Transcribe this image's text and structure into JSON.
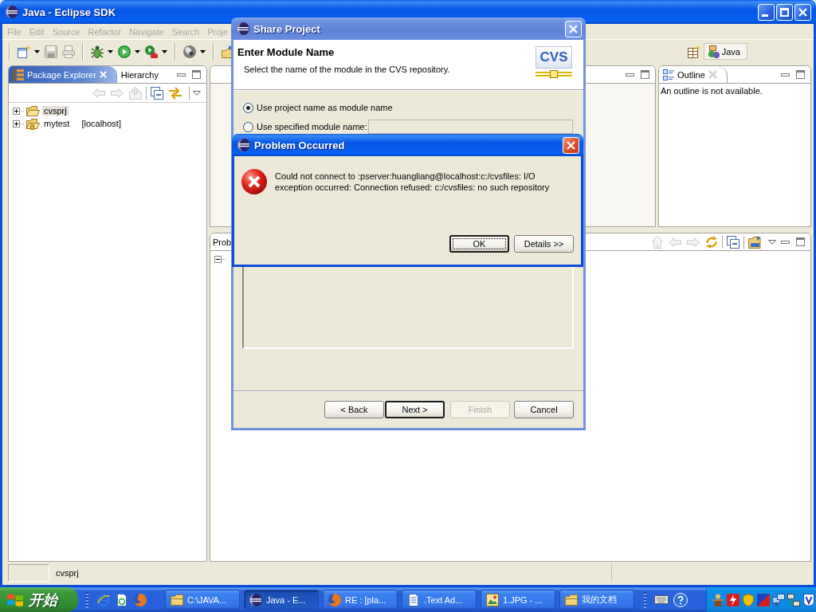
{
  "window": {
    "title": "Java - Eclipse SDK"
  },
  "menu": [
    {
      "label": "File",
      "disabled": true
    },
    {
      "label": "Edit",
      "disabled": true
    },
    {
      "label": "Source",
      "disabled": true
    },
    {
      "label": "Refactor",
      "disabled": true
    },
    {
      "label": "Navigate",
      "disabled": true
    },
    {
      "label": "Search",
      "disabled": true
    },
    {
      "label": "Proje",
      "disabled": true
    }
  ],
  "toolbar": {
    "groups": [
      [
        {
          "kind": "new",
          "dropdown": true,
          "disabled": false
        },
        {
          "kind": "save",
          "dropdown": false,
          "disabled": true
        },
        {
          "kind": "print",
          "dropdown": false,
          "disabled": true
        }
      ],
      [
        {
          "kind": "bug",
          "dropdown": true,
          "disabled": false
        },
        {
          "kind": "run",
          "dropdown": true,
          "disabled": false
        },
        {
          "kind": "run-tools",
          "dropdown": true,
          "disabled": false
        }
      ],
      [
        {
          "kind": "disc",
          "dropdown": true,
          "disabled": false
        }
      ],
      [
        {
          "kind": "folder-arrow",
          "dropdown": false,
          "disabled": false
        }
      ]
    ]
  },
  "perspectives": [
    {
      "label": "Java",
      "selected": true
    }
  ],
  "package_explorer": {
    "active": true,
    "tabs": [
      {
        "label": "Package Explorer",
        "selected": true,
        "closable": true
      },
      {
        "label": "Hierarchy",
        "selected": false,
        "closable": false
      }
    ],
    "toolbar": [
      [
        {
          "kind": "back",
          "disabled": true
        },
        {
          "kind": "forward",
          "disabled": true
        },
        {
          "kind": "up",
          "disabled": true
        }
      ],
      [
        {
          "kind": "collapse-all",
          "disabled": false
        },
        {
          "kind": "link",
          "disabled": false
        }
      ]
    ],
    "tree": [
      {
        "label": "cvsprj",
        "expanded": false,
        "selected": true,
        "shared": false
      },
      {
        "label": "mytest",
        "decoration": "[localhost]",
        "expanded": false,
        "selected": false,
        "shared": true
      }
    ]
  },
  "outline": {
    "active": false,
    "tabs": [
      {
        "label": "Outline",
        "selected": true,
        "closable": true
      }
    ],
    "message": "An outline is not available."
  },
  "problems": {
    "active": false,
    "tabs": [
      {
        "label": "Prob",
        "selected": true
      }
    ],
    "toolbar": [
      [
        {
          "kind": "home",
          "disabled": true
        },
        {
          "kind": "back",
          "disabled": true
        },
        {
          "kind": "forward",
          "disabled": true
        },
        {
          "kind": "sync",
          "disabled": false
        }
      ],
      [
        {
          "kind": "collapse-all",
          "disabled": false
        }
      ],
      [
        {
          "kind": "cvs-folder",
          "disabled": false
        }
      ]
    ],
    "tree": [
      {
        "expanded": true
      }
    ]
  },
  "status_bar": {
    "message": "cvsprj"
  },
  "share_dialog": {
    "title": "Share Project",
    "active": false,
    "heading": "Enter Module Name",
    "description": "Select the name of the module in the CVS repository.",
    "banner_logo": "CVS",
    "options": [
      {
        "label": "Use project name as module name",
        "selected": true
      },
      {
        "label": "Use specified module name:",
        "selected": false
      }
    ],
    "module_field": {
      "disabled": true
    },
    "buttons": [
      {
        "label": "< Back",
        "default": false,
        "disabled": false
      },
      {
        "label": "Next >",
        "default": true,
        "disabled": false
      },
      {
        "label": "Finish",
        "default": false,
        "disabled": true
      },
      {
        "label": "Cancel",
        "default": false,
        "disabled": false
      }
    ]
  },
  "problem_dialog": {
    "title": "Problem Occurred",
    "active": true,
    "message": "Could not connect to :pserver:huangliang@localhost:c:/cvsfiles: I/O exception occurred: Connection refused: c:/cvsfiles: no such repository",
    "buttons": [
      {
        "label": "OK",
        "focused": true
      },
      {
        "label": "Details >>",
        "focused": false
      }
    ]
  },
  "taskbar": {
    "start_label": "开始",
    "tasks": [
      {
        "label": "C:\\JAVA...",
        "kind": "folder",
        "selected": false
      },
      {
        "label": "Java - E...",
        "kind": "eclipse",
        "selected": true
      },
      {
        "label": "RE : [pla...",
        "kind": "browser",
        "selected": false
      },
      {
        "label": ".Text Ad...",
        "kind": "document",
        "selected": false
      },
      {
        "label": "1.JPG - ...",
        "kind": "picture",
        "selected": false
      },
      {
        "label": "我的文档",
        "kind": "folder",
        "selected": false
      }
    ]
  }
}
